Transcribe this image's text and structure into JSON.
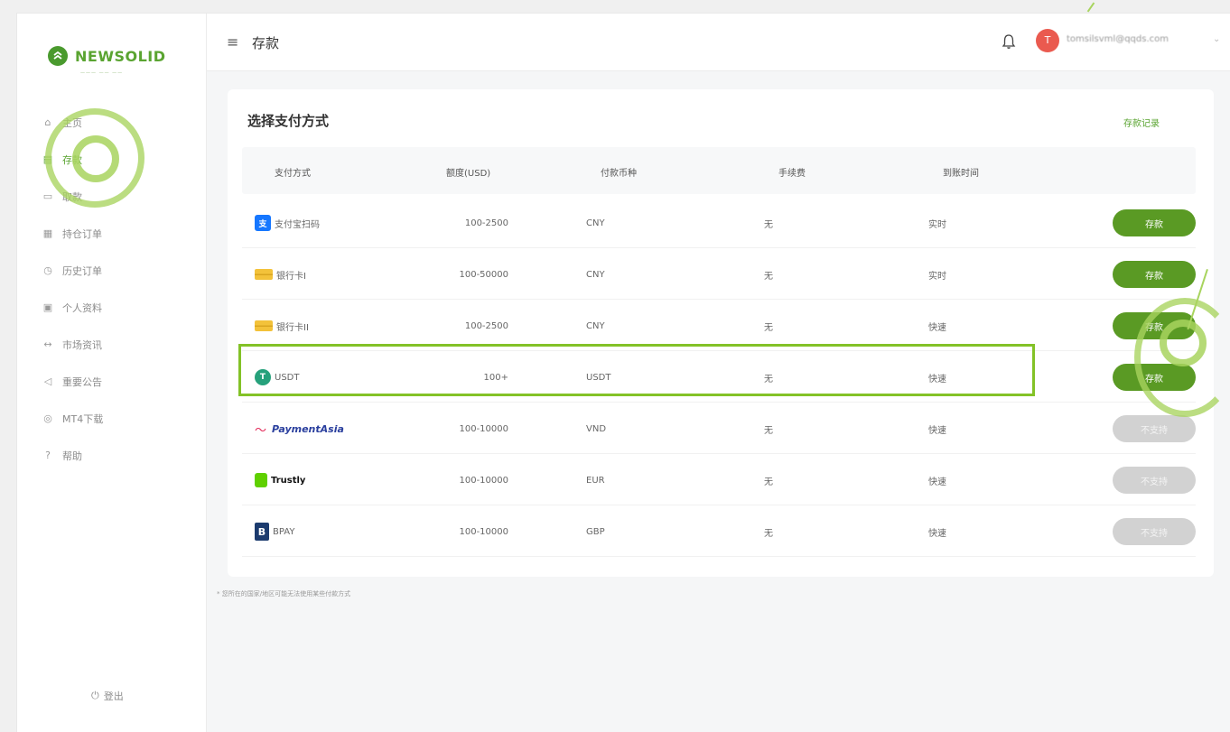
{
  "app": {
    "logo_text": "NEWSOLID",
    "logo_sub": "——— —— ——"
  },
  "sidebar": {
    "items": [
      {
        "label": "主页",
        "icon": "home-icon",
        "glyph": "⌂"
      },
      {
        "label": "存款",
        "icon": "deposit-icon",
        "glyph": "▤"
      },
      {
        "label": "取款",
        "icon": "withdraw-icon",
        "glyph": "▭"
      },
      {
        "label": "持仓订单",
        "icon": "orders-icon",
        "glyph": "▦"
      },
      {
        "label": "历史订单",
        "icon": "history-icon",
        "glyph": "◷"
      },
      {
        "label": "个人资料",
        "icon": "profile-icon",
        "glyph": "▣"
      },
      {
        "label": "市场资讯",
        "icon": "news-icon",
        "glyph": "↔"
      },
      {
        "label": "重要公告",
        "icon": "announcement-icon",
        "glyph": "◁"
      },
      {
        "label": "MT4下载",
        "icon": "download-icon",
        "glyph": "◎"
      },
      {
        "label": "帮助",
        "icon": "help-icon",
        "glyph": "?"
      }
    ],
    "active_index": 1,
    "logout_label": "登出"
  },
  "header": {
    "menu_glyph": "≡",
    "title": "存款",
    "avatar_letter": "T",
    "user_email": "tomsilsvml@qqds.com",
    "caret": "⌄"
  },
  "card": {
    "title": "选择支付方式",
    "history_link": "存款记录",
    "columns": [
      "支付方式",
      "额度(USD)",
      "付款币种",
      "手续费",
      "到账时间"
    ],
    "rows": [
      {
        "method": "支付宝扫码",
        "icon": "alipay-icon",
        "limit": "100-2500",
        "currency": "CNY",
        "fee": "无",
        "time": "实时",
        "action": "存款",
        "enabled": true
      },
      {
        "method": "银行卡I",
        "icon": "bank-card-icon",
        "limit": "100-50000",
        "currency": "CNY",
        "fee": "无",
        "time": "实时",
        "action": "存款",
        "enabled": true
      },
      {
        "method": "银行卡II",
        "icon": "bank-card-icon",
        "limit": "100-2500",
        "currency": "CNY",
        "fee": "无",
        "time": "快速",
        "action": "存款",
        "enabled": true
      },
      {
        "method": "USDT",
        "icon": "usdt-icon",
        "limit": "100+",
        "currency": "USDT",
        "fee": "无",
        "time": "快速",
        "action": "存款",
        "enabled": true
      },
      {
        "method": "PaymentAsia",
        "icon": "paymentasia-logo",
        "limit": "100-10000",
        "currency": "VND",
        "fee": "无",
        "time": "快速",
        "action": "不支持",
        "enabled": false
      },
      {
        "method": "Trustly",
        "icon": "trustly-logo",
        "limit": "100-10000",
        "currency": "EUR",
        "fee": "无",
        "time": "快速",
        "action": "不支持",
        "enabled": false
      },
      {
        "method": "BPAY",
        "icon": "bpay-icon",
        "limit": "100-10000",
        "currency": "GBP",
        "fee": "无",
        "time": "快速",
        "action": "不支持",
        "enabled": false
      }
    ]
  },
  "note": "* 您所在的国家/地区可能无法使用某些付款方式",
  "colors": {
    "accent": "#5aa431",
    "button": "#5a9a24",
    "disabled": "#d2d2d2",
    "annotation": "#83c227",
    "avatar": "#ea5a4f"
  }
}
